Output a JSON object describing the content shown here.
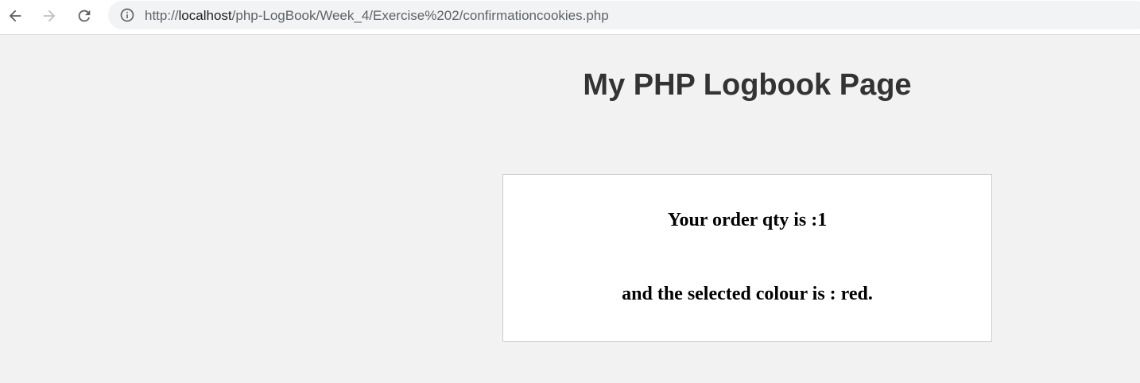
{
  "browser": {
    "url_prefix": "http://",
    "url_host": "localhost",
    "url_path": "/php-LogBook/Week_4/Exercise%202/confirmationcookies.php",
    "icons": {
      "back": "arrow-left-icon",
      "forward": "arrow-right-icon",
      "reload": "reload-icon",
      "site_info": "info-circle-icon"
    }
  },
  "page": {
    "title": "My PHP Logbook Page"
  },
  "order": {
    "qty_text": "Your order qty is :1",
    "colour_text": "and the selected colour is : red."
  },
  "colors": {
    "page_background": "#f2f2f2",
    "title_text": "#333333",
    "box_background": "#ffffff",
    "box_border": "#cccccc"
  }
}
